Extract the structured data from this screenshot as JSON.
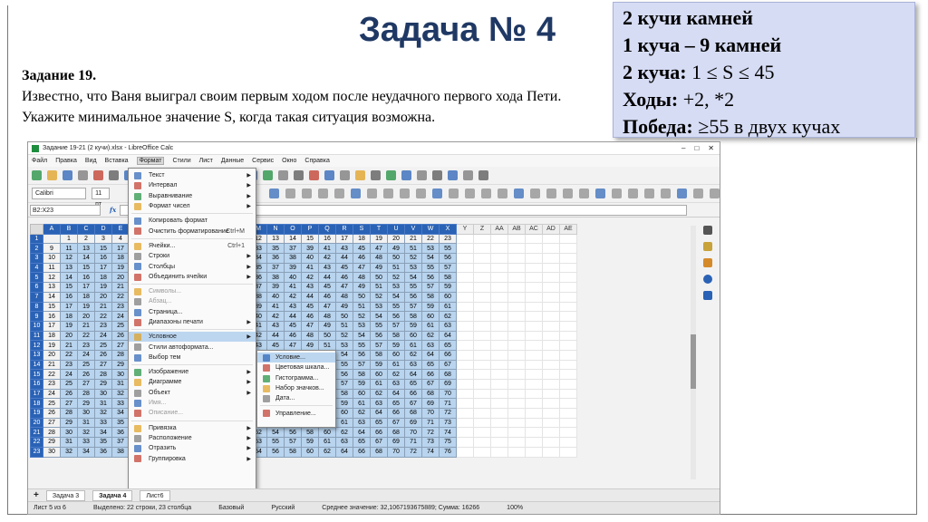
{
  "slide": {
    "title": "Задача № 4",
    "info": {
      "line1": "2 кучи камней",
      "line2": "1 куча – 9 камней",
      "line3_label": "2 куча:",
      "line3_value": " 1 ≤ S ≤ 45",
      "line4_label": "Ходы:",
      "line4_value": " +2, *2",
      "line5_label": "Победа:",
      "line5_value": " ≥55 в двух кучах"
    },
    "task_heading": "Задание 19.",
    "task_text": "Известно, что Ваня выиграл своим первым ходом после неудачного первого хода Пети. Укажите минимальное значение S, когда такая ситуация возможна."
  },
  "app": {
    "window_title": "Задание 19-21 (2 кучи).xlsx - LibreOffice Calc",
    "win_controls": [
      "–",
      "□",
      "✕"
    ],
    "menubar": [
      "Файл",
      "Правка",
      "Вид",
      "Вставка",
      "Формат",
      "Стили",
      "Лист",
      "Данные",
      "Сервис",
      "Окно",
      "Справка"
    ],
    "font_name": "Calibri",
    "font_size": "11 пт",
    "name_box": "B2:X23",
    "fx_label": "fx",
    "format_menu": [
      {
        "label": "Текст",
        "arrow": true
      },
      {
        "label": "Интервал",
        "arrow": true
      },
      {
        "label": "Выравнивание",
        "arrow": true
      },
      {
        "label": "Формат чисел",
        "arrow": true
      },
      {
        "sep": true
      },
      {
        "label": "Копировать формат"
      },
      {
        "label": "Очистить форматирование",
        "shortcut": "Ctrl+M"
      },
      {
        "sep": true
      },
      {
        "label": "Ячейки...",
        "shortcut": "Ctrl+1"
      },
      {
        "label": "Строки",
        "arrow": true
      },
      {
        "label": "Столбцы",
        "arrow": true
      },
      {
        "label": "Объединить ячейки",
        "arrow": true
      },
      {
        "sep": true
      },
      {
        "label": "Символы...",
        "disabled": true
      },
      {
        "label": "Абзац...",
        "disabled": true
      },
      {
        "label": "Страница..."
      },
      {
        "label": "Диапазоны печати",
        "arrow": true
      },
      {
        "sep": true
      },
      {
        "label": "Условное",
        "arrow": true,
        "highlight": true
      },
      {
        "label": "Стили автоформата..."
      },
      {
        "label": "Выбор тем"
      },
      {
        "sep": true
      },
      {
        "label": "Изображение",
        "arrow": true
      },
      {
        "label": "Диаграмме",
        "arrow": true
      },
      {
        "label": "Объект",
        "arrow": true
      },
      {
        "label": "Имя...",
        "disabled": true
      },
      {
        "label": "Описание...",
        "disabled": true
      },
      {
        "sep": true
      },
      {
        "label": "Привязка",
        "arrow": true
      },
      {
        "label": "Расположение",
        "arrow": true
      },
      {
        "label": "Отразить",
        "arrow": true
      },
      {
        "label": "Группировка",
        "arrow": true
      }
    ],
    "conditional_submenu": [
      {
        "label": "Условие...",
        "highlight": true
      },
      {
        "label": "Цветовая шкала..."
      },
      {
        "label": "Гистограмма..."
      },
      {
        "label": "Набор значков..."
      },
      {
        "label": "Дата..."
      },
      {
        "sep": true
      },
      {
        "label": "Управление..."
      }
    ],
    "columns": [
      "A",
      "B",
      "C",
      "D",
      "E",
      "F",
      "G",
      "H",
      "I",
      "J",
      "K",
      "L",
      "M",
      "N",
      "O",
      "P",
      "Q",
      "R",
      "S",
      "T",
      "U",
      "V",
      "W",
      "X"
    ],
    "columns_plain": [
      "Y",
      "Z",
      "AA",
      "AB",
      "AC",
      "AD",
      "AE"
    ],
    "row_headers": [
      "1",
      "2",
      "3",
      "4",
      "5",
      "6",
      "7",
      "8",
      "9",
      "10",
      "11",
      "12",
      "13",
      "14",
      "15",
      "16",
      "17",
      "18",
      "19",
      "20",
      "21",
      "22",
      "23"
    ],
    "header_row_values": [
      "",
      "1",
      "2",
      "3",
      "4",
      "5",
      "6",
      "7",
      "8",
      "9",
      "10",
      "11",
      "12",
      "13",
      "14",
      "15",
      "16",
      "17",
      "18",
      "19",
      "20",
      "21",
      "22",
      "23"
    ],
    "first_col_values": [
      "9",
      "10",
      "11",
      "12",
      "13",
      "14",
      "15",
      "16",
      "17",
      "18",
      "19",
      "20",
      "21",
      "22",
      "23",
      "24",
      "25",
      "26",
      "27",
      "28",
      "29",
      "30"
    ],
    "sheet_tabs": [
      "Задача 3",
      "Задача 4",
      "Лист6"
    ],
    "status": [
      "Лист 5 из 6",
      "Выделено: 22 строки, 23 столбца",
      "Базовый",
      "Русский",
      "Среднее значение: 32,1067193675889; Сумма: 16266",
      "100%"
    ]
  }
}
